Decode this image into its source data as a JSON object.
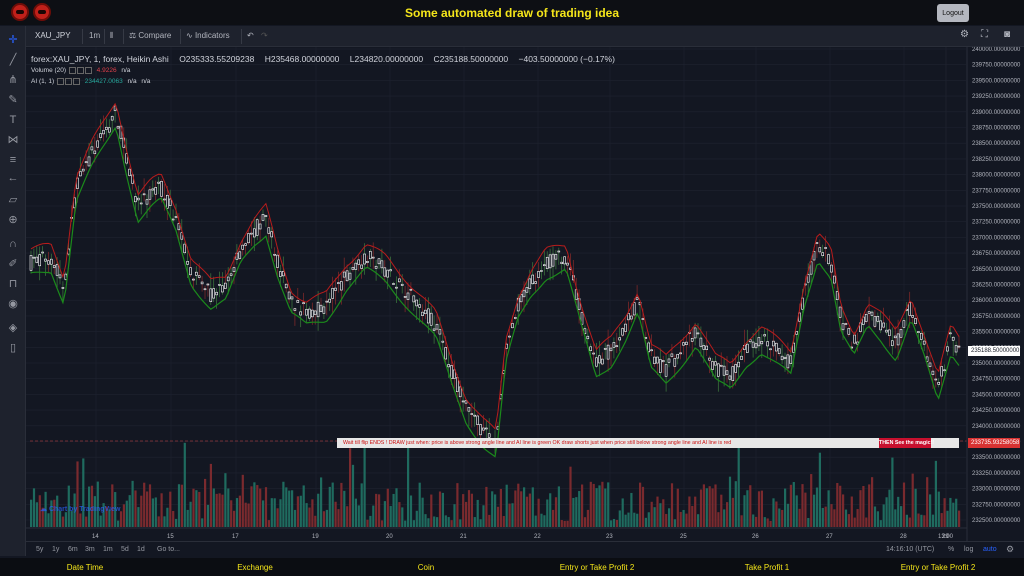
{
  "page": {
    "title": "Some automated draw of trading idea",
    "logout_label": "Logout"
  },
  "toolbar": {
    "symbol": "XAU_JPY",
    "interval": "1m",
    "compare_label": "Compare",
    "indicators_label": "Indicators"
  },
  "legend": {
    "series_name": "forex:XAU_JPY, 1, forex, Heikin Ashi",
    "open": "O235333.55209238",
    "high": "H235468.00000000",
    "low": "L234820.00000000",
    "close": "C235188.50000000",
    "change": "−403.50000000 (−0.17%)"
  },
  "studies": [
    {
      "name": "Volume (20)",
      "value": "4.9226",
      "value2": "n/a",
      "value_color": "#e0404a"
    },
    {
      "name": "AI (1, 1)",
      "value": "234427.0063",
      "value2": "n/a",
      "value3": "n/a",
      "value_color": "#26a69a"
    }
  ],
  "banner": {
    "text": "Wait till flip ENDS !   DRAW just when:  price is above strong angle line and AI line is green        OK        draw shorts just when price still below strong angle line and AI line is red",
    "magic_label": "THEN See the magic!!"
  },
  "watermark": "Chart by TradingView",
  "price_axis": {
    "labels": [
      "240000.00000000",
      "239750.00000000",
      "239500.00000000",
      "239250.00000000",
      "239000.00000000",
      "238750.00000000",
      "238500.00000000",
      "238250.00000000",
      "238000.00000000",
      "237750.00000000",
      "237500.00000000",
      "237250.00000000",
      "237000.00000000",
      "236750.00000000",
      "236500.00000000",
      "236250.00000000",
      "236000.00000000",
      "235750.00000000",
      "235500.00000000",
      "235250.00000000",
      "235000.00000000",
      "234750.00000000",
      "234500.00000000",
      "234250.00000000",
      "234000.00000000",
      "233750.00000000",
      "233500.00000000",
      "233250.00000000",
      "233000.00000000",
      "232750.00000000",
      "232500.00000000"
    ],
    "current_price": "235188.50000000",
    "marker_price": "233735.93258058"
  },
  "time_axis": {
    "labels": [
      "14",
      "15",
      "17",
      "19",
      "20",
      "21",
      "22",
      "23",
      "25",
      "26",
      "27",
      "28",
      "29",
      "13:00"
    ]
  },
  "bottom": {
    "ranges": [
      "5y",
      "1y",
      "6m",
      "3m",
      "1m",
      "5d",
      "1d"
    ],
    "goto_label": "Go to...",
    "clock": "14:16:10 (UTC)",
    "percent_label": "%",
    "log_label": "log",
    "auto_label": "auto"
  },
  "footer": {
    "items": [
      "Date Time",
      "Exchange",
      "Coin",
      "Entry or Take Profit 2",
      "Take Profit 1",
      "Entry or Take Profit 2"
    ]
  },
  "colors": {
    "background": "#131722",
    "candle_body": "#ffffff",
    "fast_line": "#b71c1c",
    "ai_line": "#1b8a1b",
    "volume_up": "#26a69a",
    "volume_down": "#ef5350",
    "title_yellow": "#f5e61a"
  }
}
